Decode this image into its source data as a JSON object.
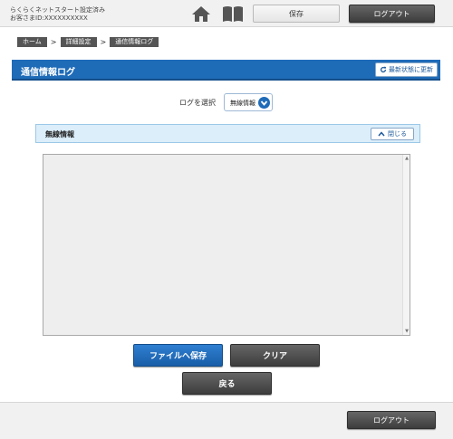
{
  "header": {
    "status_line1": "らくらくネットスタート設定済み",
    "status_line2": "お客さまID:XXXXXXXXXX",
    "home_icon": "home-icon",
    "manual_icon": "book-icon",
    "save_label": "保存",
    "logout_label": "ログアウト"
  },
  "breadcrumb": {
    "items": [
      "ホーム",
      "詳細設定",
      "通信情報ログ"
    ],
    "separator": ">"
  },
  "page": {
    "title": "通信情報ログ",
    "refresh_label": "最新状態に更新",
    "accent_color": "#1e6bb8"
  },
  "log_select": {
    "label": "ログを選択",
    "selected": "無線情報"
  },
  "section": {
    "title": "無線情報",
    "close_label": "閉じる"
  },
  "log_area": {
    "content": ""
  },
  "actions": {
    "file_save_label": "ファイルへ保存",
    "clear_label": "クリア",
    "back_label": "戻る"
  },
  "footer": {
    "logout_label": "ログアウト"
  }
}
